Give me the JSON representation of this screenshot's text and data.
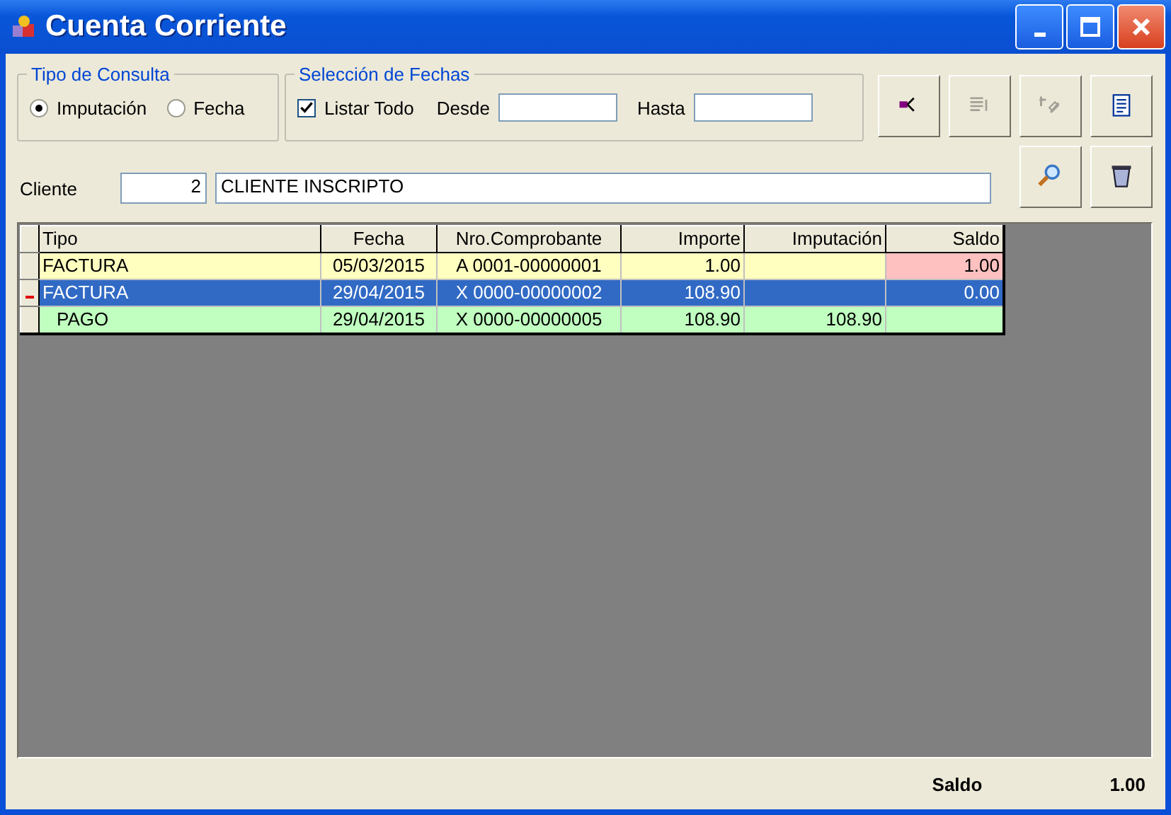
{
  "window": {
    "title": "Cuenta Corriente"
  },
  "tipo_consulta": {
    "legend": "Tipo de Consulta",
    "options": [
      {
        "label": "Imputación",
        "selected": true
      },
      {
        "label": "Fecha",
        "selected": false
      }
    ]
  },
  "seleccion_fechas": {
    "legend": "Selección de Fechas",
    "listar_todo": {
      "label": "Listar Todo",
      "checked": true
    },
    "desde": {
      "label": "Desde"
    },
    "hasta": {
      "label": "Hasta"
    }
  },
  "toolbar": [
    {
      "kind": "tree",
      "disabled": false
    },
    {
      "kind": "list",
      "disabled": true
    },
    {
      "kind": "money",
      "disabled": true
    },
    {
      "kind": "document",
      "disabled": false
    },
    {
      "kind": "search",
      "disabled": false
    },
    {
      "kind": "trash",
      "disabled": false
    }
  ],
  "cliente": {
    "label": "Cliente",
    "code": "2",
    "name": "CLIENTE INSCRIPTO"
  },
  "table": {
    "columns": [
      "Tipo",
      "Fecha",
      "Nro.Comprobante",
      "Importe",
      "Imputación",
      "Saldo"
    ],
    "rows": [
      {
        "kind": "factura",
        "selected": false,
        "color": "#ffffc0",
        "saldo_alert": true,
        "cells": [
          "FACTURA",
          "05/03/2015",
          "A 0001-00000001",
          "1.00",
          "",
          "1.00"
        ]
      },
      {
        "kind": "factura",
        "selected": true,
        "cells": [
          "FACTURA",
          "29/04/2015",
          "X 0000-00000002",
          "108.90",
          "",
          "0.00"
        ]
      },
      {
        "kind": "pago",
        "selected": false,
        "color": "#c0ffc0",
        "saldo_alert": false,
        "cells": [
          "PAGO",
          "29/04/2015",
          "X 0000-00000005",
          "108.90",
          "108.90",
          ""
        ]
      }
    ]
  },
  "footer": {
    "label": "Saldo",
    "value": "1.00"
  }
}
